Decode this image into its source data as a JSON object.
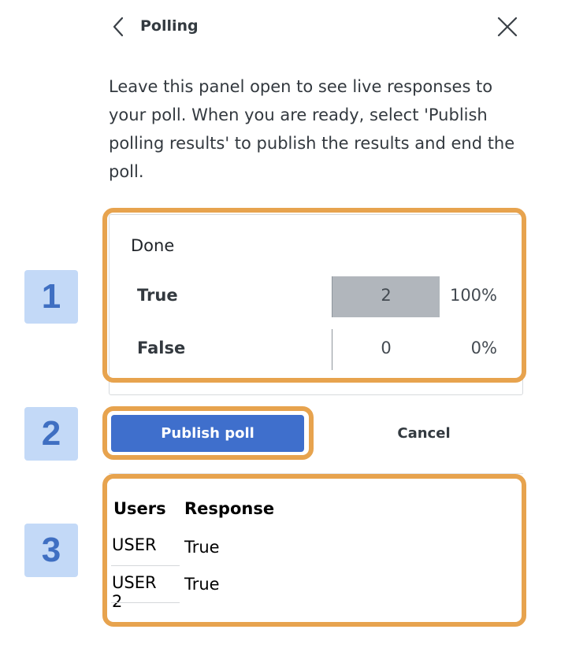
{
  "header": {
    "title": "Polling",
    "back_icon": "chevron-left-icon",
    "close_icon": "close-icon"
  },
  "intro_text": "Leave this panel open to see live responses to your poll. When you are ready, select 'Publish polling results' to publish the results and end the poll.",
  "steps": [
    "1",
    "2",
    "3"
  ],
  "results": {
    "status": "Done",
    "options": [
      {
        "label": "True",
        "count": "2",
        "percent": "100%",
        "fraction": 1.0
      },
      {
        "label": "False",
        "count": "0",
        "percent": "0%",
        "fraction": 0.0
      }
    ]
  },
  "actions": {
    "publish_label": "Publish poll",
    "cancel_label": "Cancel"
  },
  "responses": {
    "headers": {
      "users": "Users",
      "response": "Response"
    },
    "rows": [
      {
        "user": "USER",
        "response": "True"
      },
      {
        "user": "USER 2",
        "response": "True"
      }
    ]
  },
  "colors": {
    "highlight": "#e7a34e",
    "badge_bg": "#c3d9f7",
    "badge_text": "#3f6fc2",
    "primary": "#3f6fcc",
    "bar_fill": "#b1b6bc"
  }
}
